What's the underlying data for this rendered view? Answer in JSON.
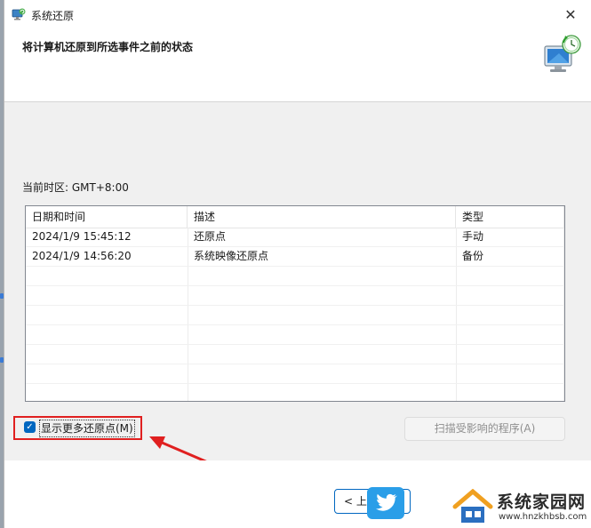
{
  "window": {
    "title": "系统还原",
    "close_glyph": "✕"
  },
  "header": {
    "title": "将计算机还原到所选事件之前的状态",
    "icon": "system-restore-computer-icon"
  },
  "content": {
    "timezone_label": "当前时区: GMT+8:00",
    "list": {
      "columns": [
        "日期和时间",
        "描述",
        "类型"
      ],
      "sort_indicator": "˅",
      "rows": [
        {
          "datetime": "2024/1/9 15:45:12",
          "description": "还原点",
          "type": "手动"
        },
        {
          "datetime": "2024/1/9 14:56:20",
          "description": "系统映像还原点",
          "type": "备份"
        }
      ]
    },
    "show_more": {
      "label": "显示更多还原点(M)",
      "checked": true,
      "check_glyph": "✓"
    },
    "scan_button": "扫描受影响的程序(A)"
  },
  "footer": {
    "back_button": "< 上一",
    "watermark_title": "系统家园网",
    "watermark_url": "www.hnzkhbsb.com"
  },
  "colors": {
    "accent": "#0067c0",
    "highlight_red": "#e02020",
    "content_bg": "#f0f0f0",
    "twitter_blue": "#2a9ee8"
  }
}
